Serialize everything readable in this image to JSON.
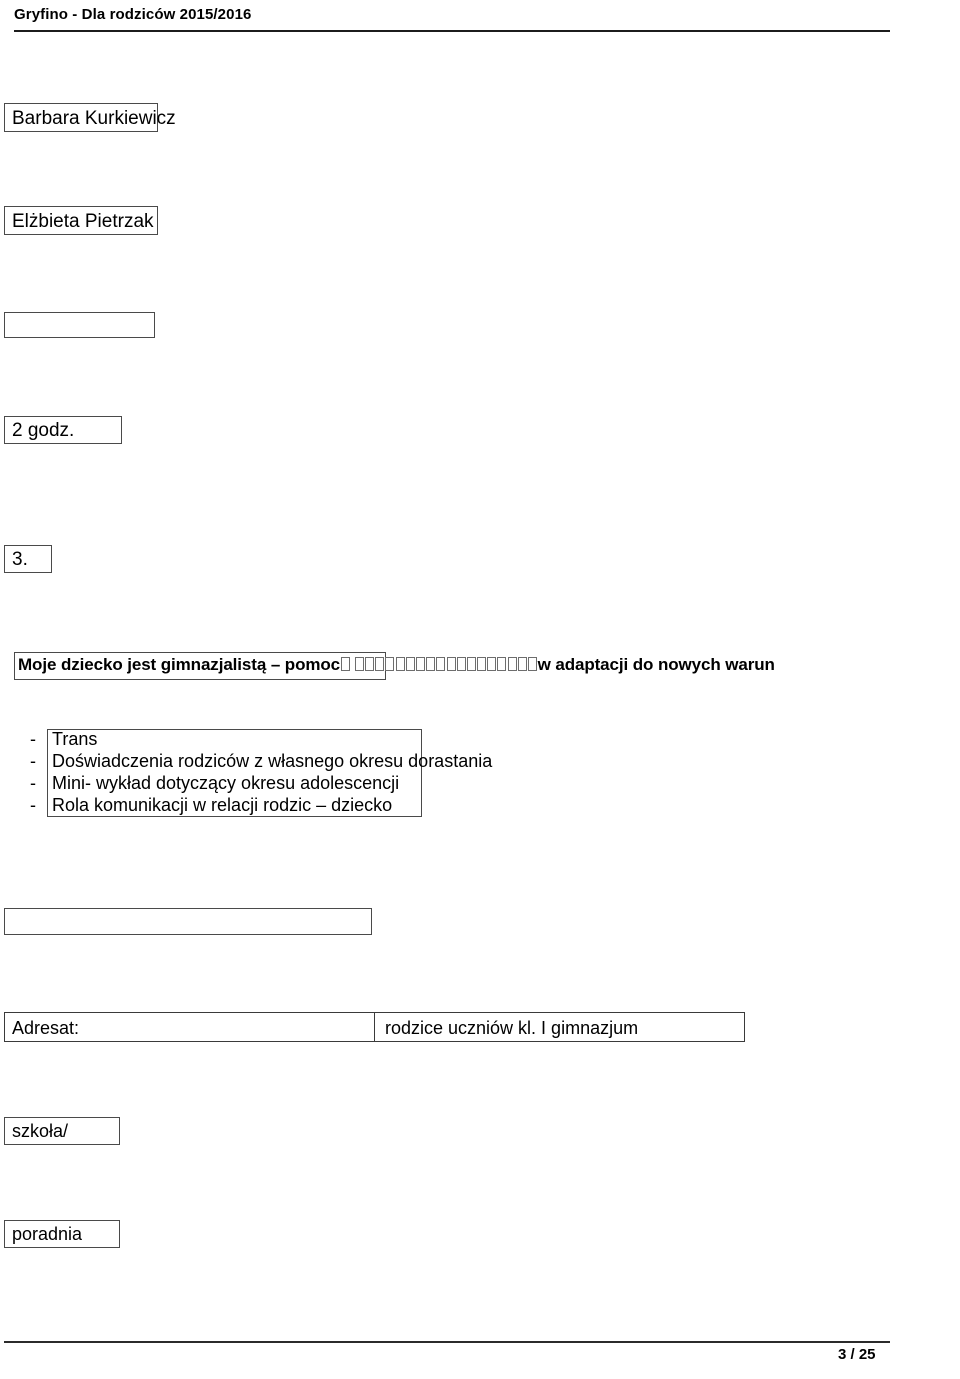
{
  "header": {
    "title": "Gryfino - Dla rodziców 2015/2016"
  },
  "body": {
    "presenter_1": "Barbara Kurkiewicz",
    "presenter_2": "Elżbieta  Pietrzak",
    "duration": "2 godz.",
    "item_number": "3.",
    "title_before_glyphs": "Moje dziecko   jest gimnazjalistą – pomoc",
    "title_after_glyphs": "w adaptacji do nowych   warun",
    "missing_glyph_count_1": 1,
    "missing_glyph_count_2": 18,
    "bullets": [
      {
        "dash": "-",
        "text": "Trans"
      },
      {
        "dash": "-",
        "text": "Doświadczenia rodziców z własnego okresu dorastania"
      },
      {
        "dash": "-",
        "text": "Mini- wykład dotyczący okresu adolescencji"
      },
      {
        "dash": "-",
        "text": "Rola komunikacji w relacji rodzic – dziecko"
      }
    ],
    "adresat_label": "Adresat:",
    "adresat_value": "rodzice uczniów kl. I    gimnazjum",
    "provider_1": "szkoła/",
    "provider_2": "poradnia"
  },
  "footer": {
    "page": "3 / 25"
  },
  "colors": {
    "text": "#000000",
    "rule": "#1c1c1c",
    "box_border": "#4a4a4a",
    "background": "#ffffff"
  }
}
